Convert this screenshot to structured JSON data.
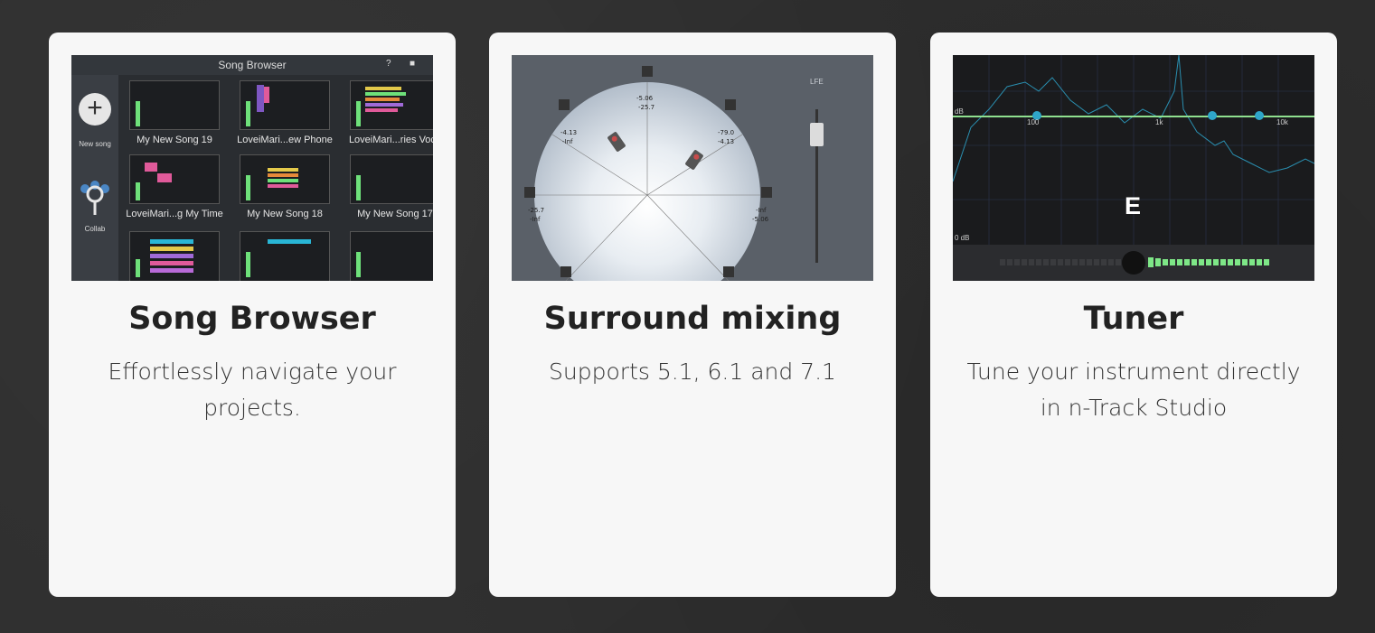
{
  "cards": [
    {
      "title": "Song Browser",
      "description": "Effortlessly navigate your projects.",
      "screenshot": {
        "header": "Song Browser",
        "side_items": [
          "New song",
          "Collab"
        ],
        "songs": [
          "My New Song 19",
          "LoveiMari...ew Phone",
          "LoveiMari...ries Voca",
          "LoveiMari...g My Time",
          "My New Song 18",
          "My New Song 17"
        ]
      }
    },
    {
      "title": "Surround mixing",
      "description": "Supports 5.1, 6.1 and 7.1",
      "screenshot": {
        "lfe_label": "LFE",
        "readouts": [
          "-5.06",
          "-25.7",
          "-4.13",
          "-Inf",
          "-79.0",
          "-4.13",
          "-25.7",
          "-Inf",
          "-Inf",
          "-5.06"
        ]
      }
    },
    {
      "title": "Tuner",
      "description": "Tune your instrument directly in n-Track Studio",
      "screenshot": {
        "note": "E",
        "freq_labels": [
          "100",
          "1k",
          "10k"
        ],
        "db_labels": [
          "dB",
          "0 dB"
        ],
        "markers": [
          "1",
          "2",
          "3"
        ]
      }
    }
  ],
  "colors": {
    "background": "#2e2e2e",
    "card": "#f7f7f7",
    "tuner_line": "#8fe08f"
  }
}
